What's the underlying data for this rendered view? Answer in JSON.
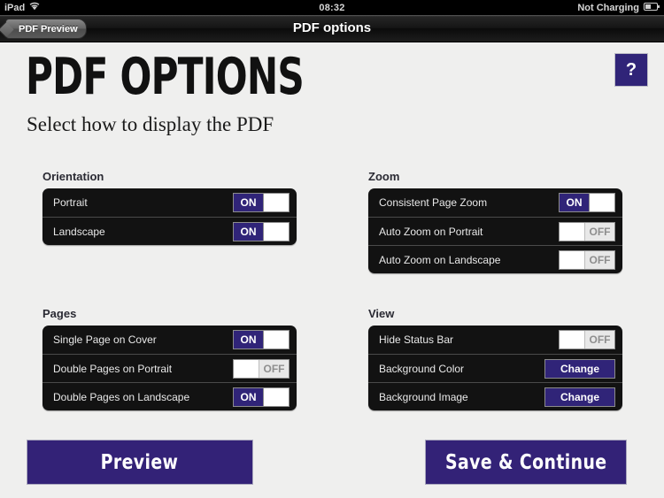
{
  "status_bar": {
    "carrier": "iPad",
    "wifi_icon": "wifi-icon",
    "time": "08:32",
    "battery_label": "Not Charging",
    "battery_icon": "battery-icon"
  },
  "nav_bar": {
    "back_label": "PDF Preview",
    "title": "PDF options"
  },
  "header": {
    "title": "PDF OPTIONS",
    "subtitle": "Select how to display the PDF",
    "help_label": "?"
  },
  "groups": [
    {
      "label": "Orientation",
      "rows": [
        {
          "label": "Portrait",
          "control": "toggle",
          "state": "ON"
        },
        {
          "label": "Landscape",
          "control": "toggle",
          "state": "ON"
        }
      ]
    },
    {
      "label": "Zoom",
      "rows": [
        {
          "label": "Consistent Page Zoom",
          "control": "toggle",
          "state": "ON"
        },
        {
          "label": "Auto Zoom on Portrait",
          "control": "toggle",
          "state": "OFF"
        },
        {
          "label": "Auto Zoom on Landscape",
          "control": "toggle",
          "state": "OFF"
        }
      ]
    },
    {
      "label": "Pages",
      "rows": [
        {
          "label": "Single Page on Cover",
          "control": "toggle",
          "state": "ON"
        },
        {
          "label": "Double Pages on Portrait",
          "control": "toggle",
          "state": "OFF"
        },
        {
          "label": "Double Pages on Landscape",
          "control": "toggle",
          "state": "ON"
        }
      ]
    },
    {
      "label": "View",
      "rows": [
        {
          "label": "Hide Status Bar",
          "control": "toggle",
          "state": "OFF"
        },
        {
          "label": "Background Color",
          "control": "button",
          "state": "Change"
        },
        {
          "label": "Background Image",
          "control": "button",
          "state": "Change"
        }
      ]
    }
  ],
  "footer": {
    "preview_label": "Preview",
    "save_label": "Save & Continue"
  },
  "colors": {
    "accent": "#302478",
    "footer_accent": "#332277",
    "panel": "#121212",
    "page_background": "#efefee"
  }
}
